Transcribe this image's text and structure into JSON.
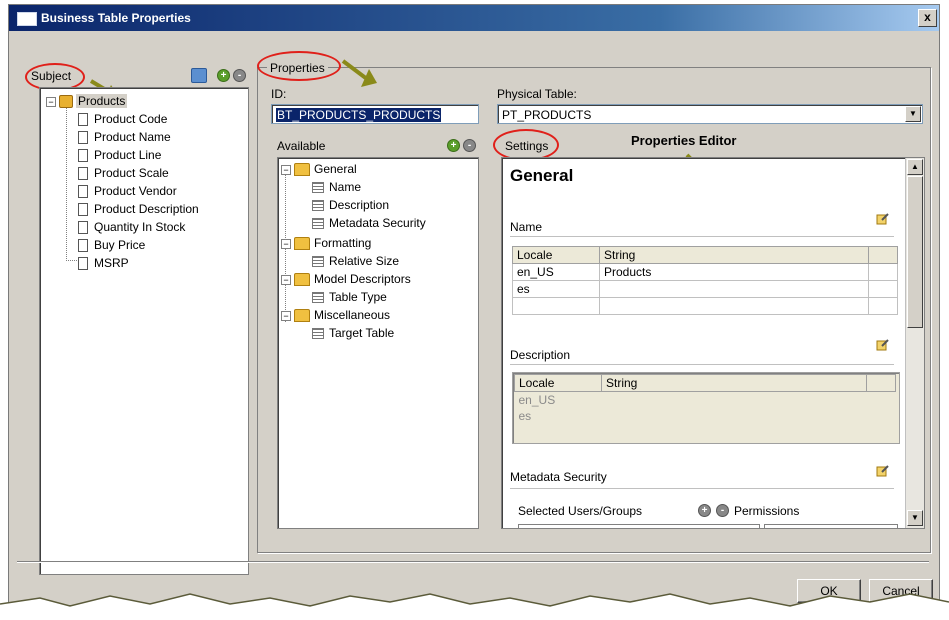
{
  "window": {
    "title": "Business Table Properties",
    "close_label": "x"
  },
  "subject": {
    "label": "Subject",
    "root": "Products",
    "items": [
      "Product Code",
      "Product Name",
      "Product Line",
      "Product Scale",
      "Product Vendor",
      "Product Description",
      "Quantity In Stock",
      "Buy Price",
      "MSRP"
    ]
  },
  "properties": {
    "label": "Properties",
    "id_label": "ID:",
    "id_value": "BT_PRODUCTS_PRODUCTS",
    "physical_table_label": "Physical Table:",
    "physical_table_value": "PT_PRODUCTS",
    "available_label": "Available",
    "tree": [
      {
        "group": "General",
        "children": [
          "Name",
          "Description",
          "Metadata Security"
        ]
      },
      {
        "group": "Formatting",
        "children": [
          "Relative Size"
        ]
      },
      {
        "group": "Model Descriptors",
        "children": [
          "Table Type"
        ]
      },
      {
        "group": "Miscellaneous",
        "children": [
          "Target Table"
        ]
      }
    ]
  },
  "settings": {
    "label": "Settings",
    "annotation": "Properties Editor",
    "heading": "General",
    "name_section": {
      "label": "Name",
      "columns": [
        "Locale",
        "String"
      ],
      "rows": [
        [
          "en_US",
          "Products"
        ],
        [
          "es",
          ""
        ]
      ]
    },
    "description_section": {
      "label": "Description",
      "columns": [
        "Locale",
        "String"
      ],
      "rows": [
        [
          "en_US",
          ""
        ],
        [
          "es",
          ""
        ]
      ]
    },
    "security_section": {
      "label": "Metadata Security",
      "users_label": "Selected Users/Groups",
      "permissions_label": "Permissions"
    }
  },
  "buttons": {
    "ok": "OK",
    "cancel": "Cancel"
  },
  "colors": {
    "annotation_ring": "#e0201a",
    "arrow": "#8a8a1a",
    "title_bar": "#0a246a"
  }
}
